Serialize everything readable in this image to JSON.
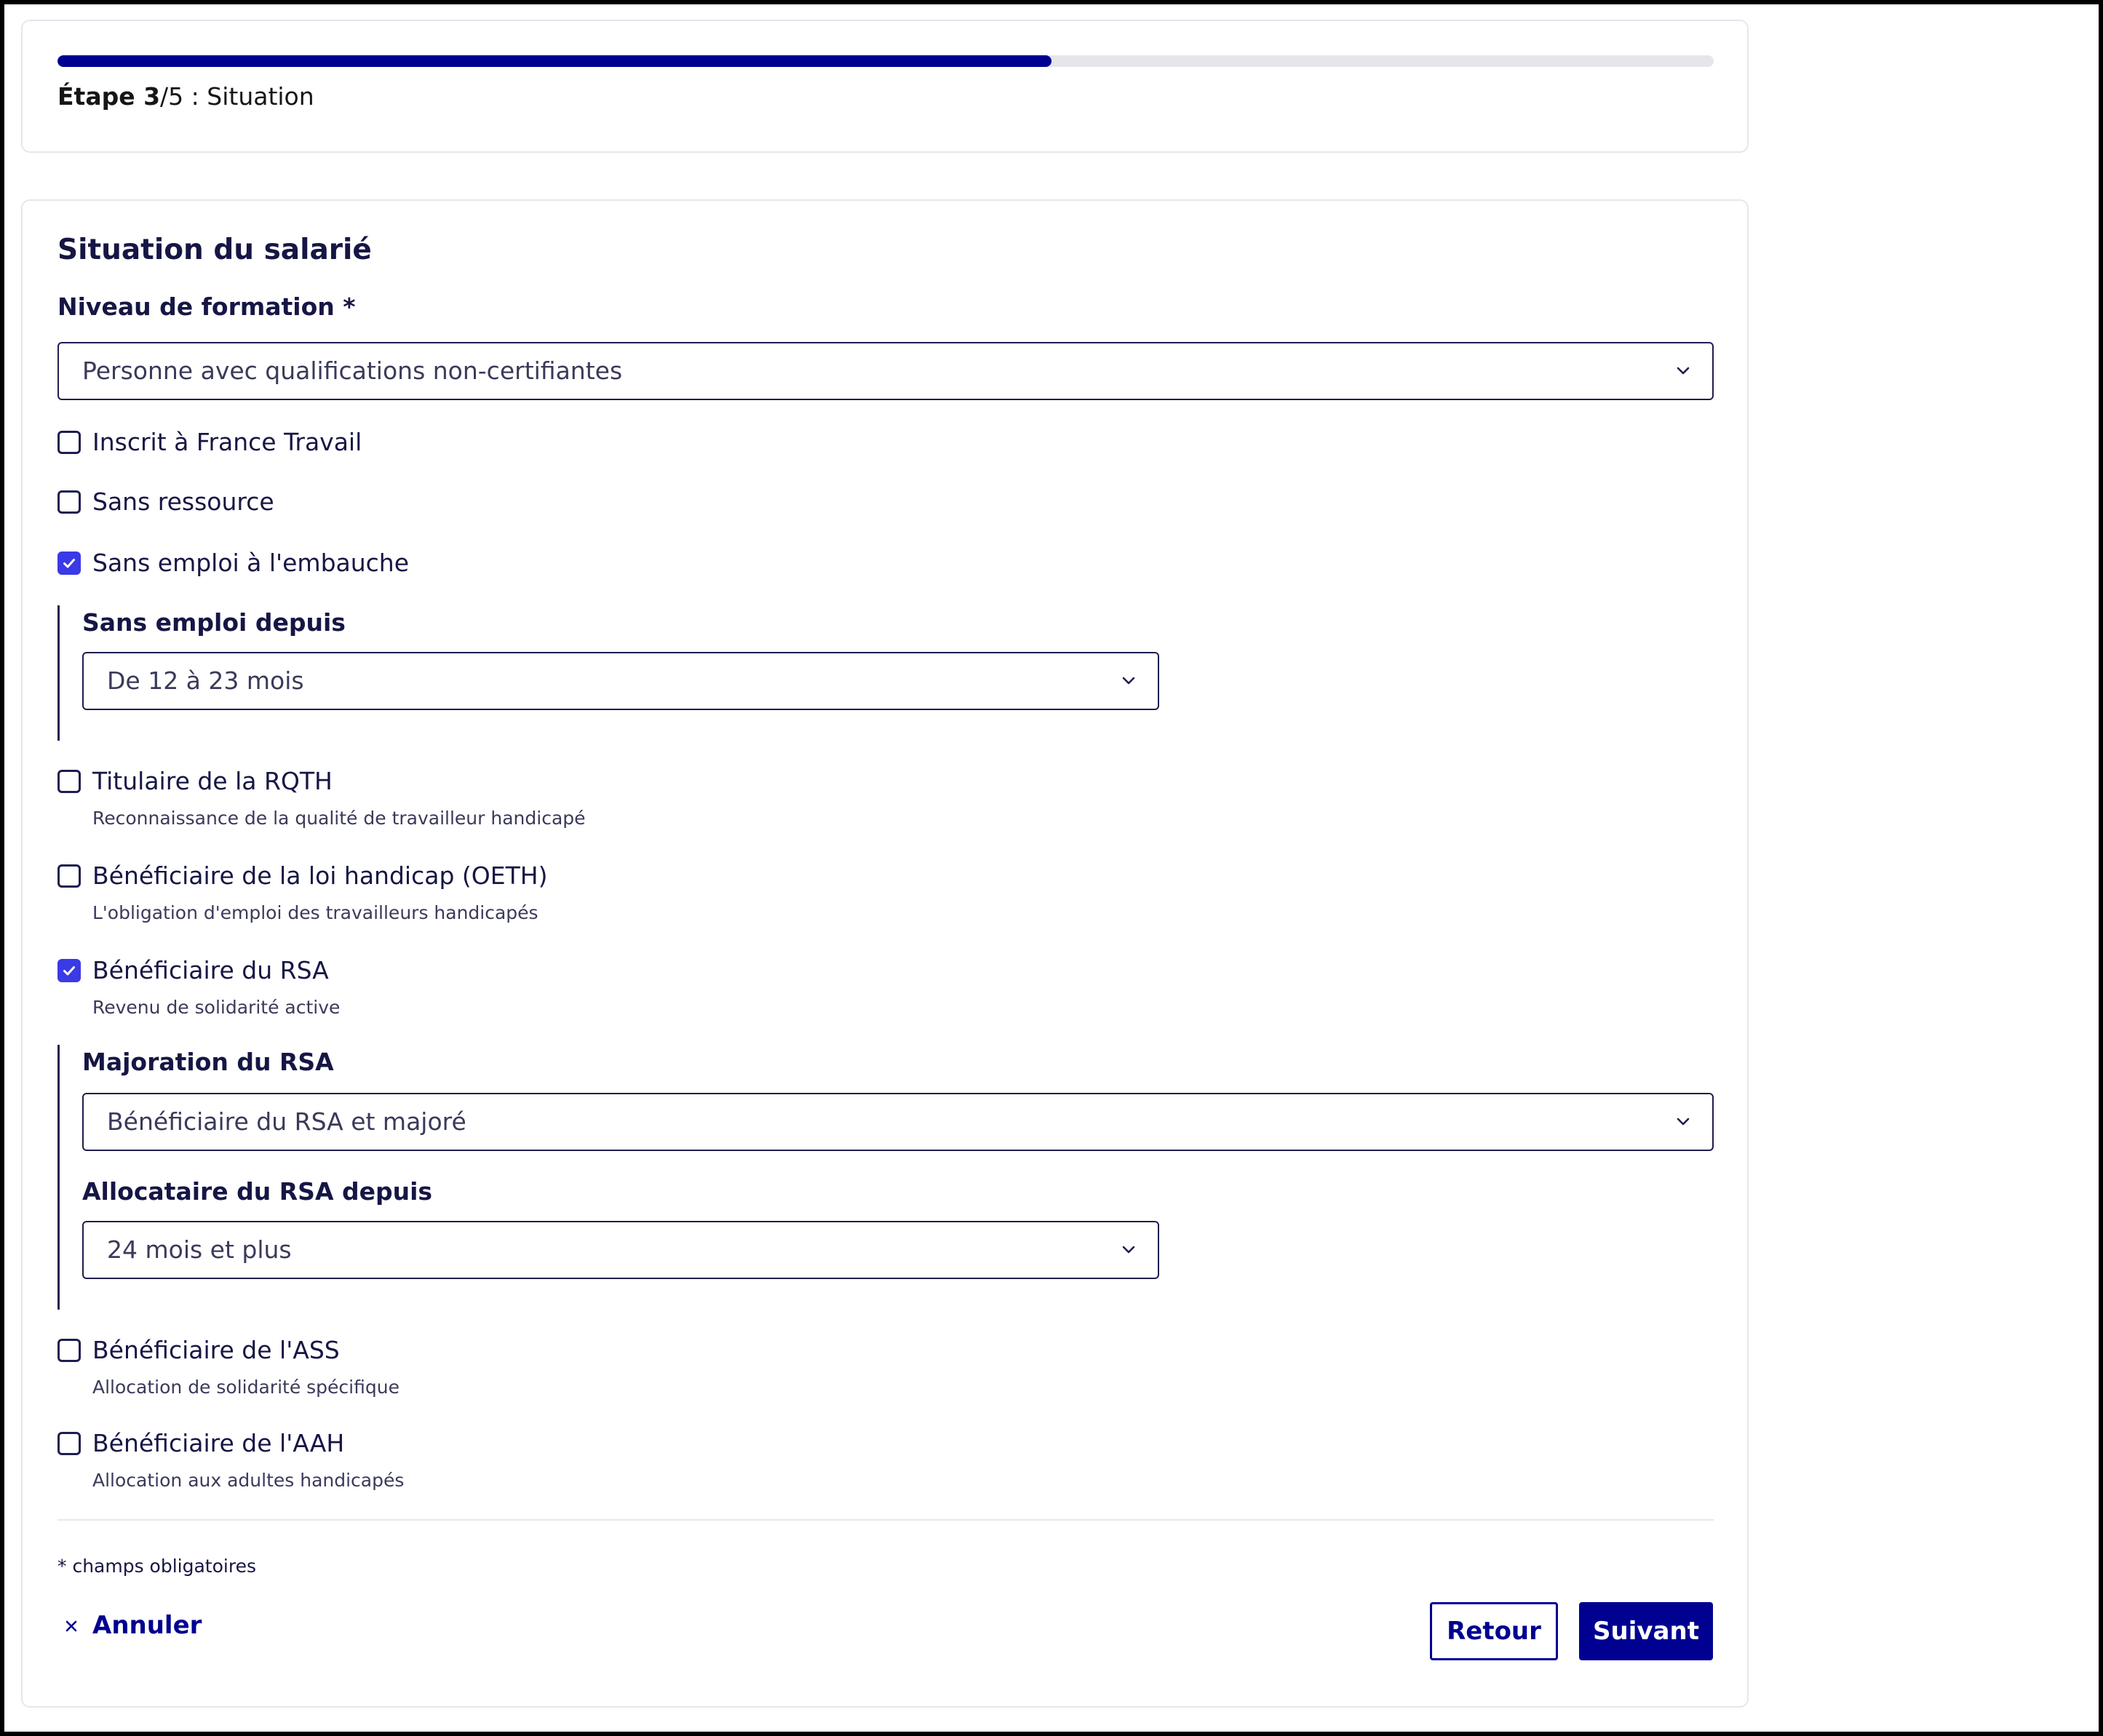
{
  "progress": {
    "step_bold": "Étape 3",
    "step_rest": "/5 : Situation",
    "fraction": 0.6
  },
  "form": {
    "title": "Situation du salarié",
    "niveau_formation": {
      "label": "Niveau de formation *",
      "value": "Personne avec qualifications non-certifiantes"
    },
    "checkboxes": {
      "france_travail": {
        "label": "Inscrit à France Travail",
        "checked": false
      },
      "sans_ressource": {
        "label": "Sans ressource",
        "checked": false
      },
      "sans_emploi": {
        "label": "Sans emploi à l'embauche",
        "checked": true
      },
      "rqth": {
        "label": "Titulaire de la RQTH",
        "hint": "Reconnaissance de la qualité de travailleur handicapé",
        "checked": false
      },
      "oeth": {
        "label": "Bénéficiaire de la loi handicap (OETH)",
        "hint": "L'obligation d'emploi des travailleurs handicapés",
        "checked": false
      },
      "rsa": {
        "label": "Bénéficiaire du RSA",
        "hint": "Revenu de solidarité active",
        "checked": true
      },
      "ass": {
        "label": "Bénéficiaire de l'ASS",
        "hint": "Allocation de solidarité spécifique",
        "checked": false
      },
      "aah": {
        "label": "Bénéficiaire de l'AAH",
        "hint": "Allocation aux adultes handicapés",
        "checked": false
      }
    },
    "sans_emploi_depuis": {
      "label": "Sans emploi depuis",
      "value": "De 12 à 23 mois"
    },
    "majoration_rsa": {
      "label": "Majoration du RSA",
      "value": "Bénéficiaire du RSA et majoré"
    },
    "rsa_depuis": {
      "label": "Allocataire du RSA depuis",
      "value": "24 mois et plus"
    },
    "required_note": "* champs obligatoires"
  },
  "actions": {
    "cancel_label": "Annuler",
    "back_label": "Retour",
    "next_label": "Suivant"
  },
  "colors": {
    "primary": "#000091",
    "checkbox_checked": "#3a3ae6",
    "text": "#161645"
  },
  "icons": {
    "chevron": "chevron-down-icon",
    "check": "check-icon",
    "close": "close-icon"
  }
}
